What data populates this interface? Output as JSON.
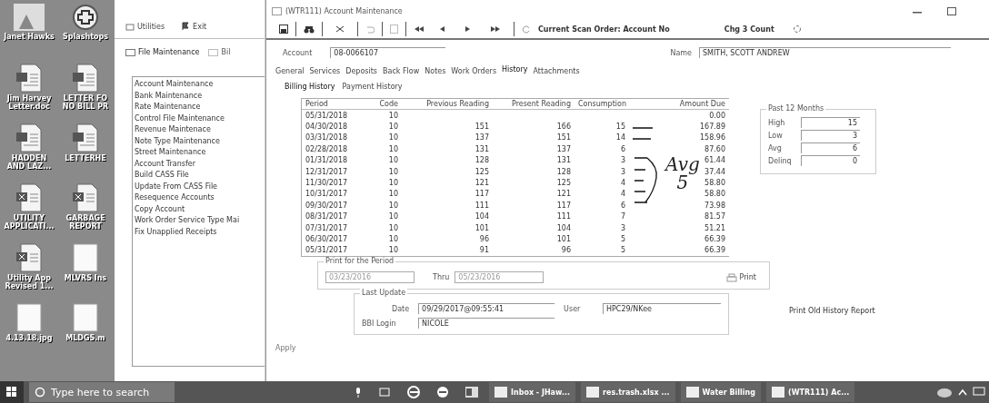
{
  "desktop_icons": [
    {
      "label": "Janet Hawks",
      "kind": "photo"
    },
    {
      "label": "Splashtops",
      "kind": "app"
    },
    {
      "label": "Jim Harvey Letter.doc",
      "kind": "word"
    },
    {
      "label": "LETTER FO NO BILL PR",
      "kind": "word"
    },
    {
      "label": "HADDEN AND LAZ...",
      "kind": "word"
    },
    {
      "label": "LETTERHE",
      "kind": "word"
    },
    {
      "label": "UTILITY APPLICATI...",
      "kind": "excel"
    },
    {
      "label": "GARBAGE REPORT",
      "kind": "excel"
    },
    {
      "label": "Utility App Revised 1...",
      "kind": "excel"
    },
    {
      "label": "MLVRS Ins",
      "kind": "blank"
    },
    {
      "label": "4.13.18.jpg",
      "kind": "blank"
    },
    {
      "label": "MLDGS.m",
      "kind": "blank"
    }
  ],
  "back_window": {
    "toolbar": [
      "Utilities",
      "Exit"
    ],
    "tabs": [
      {
        "label": "File Maintenance",
        "selected": true
      },
      {
        "label": "Bil",
        "selected": false
      }
    ],
    "items": [
      "Account Maintenance",
      "Bank Maintenance",
      "Rate Maintenance",
      "Control File Maintenance",
      "Revenue Maintenace",
      "Note Type Maintenance",
      "Street Maintenance",
      "Account Transfer",
      "Build CASS File",
      "Update From CASS File",
      "Resequence Accounts",
      "Copy Account",
      "Work Order Service Type Mai",
      "Fix Unapplied Receipts"
    ]
  },
  "window": {
    "title": "(WTR111) Account Maintenance",
    "scan_order": "Current Scan Order: Account No",
    "count": "Chg 3 Count"
  },
  "account": {
    "label": "Account",
    "value": "08-0066107"
  },
  "name": {
    "label": "Name",
    "value": "SMITH, SCOTT ANDREW"
  },
  "tabs": [
    {
      "label": "General",
      "selected": false
    },
    {
      "label": "Services",
      "selected": false
    },
    {
      "label": "Deposits",
      "selected": false
    },
    {
      "label": "Back Flow",
      "selected": false
    },
    {
      "label": "Notes",
      "selected": false
    },
    {
      "label": "Work Orders",
      "selected": false
    },
    {
      "label": "History",
      "selected": true
    },
    {
      "label": "Attachments",
      "selected": false
    }
  ],
  "subtabs": [
    {
      "label": "Billing History",
      "selected": true
    },
    {
      "label": "Payment History",
      "selected": false
    }
  ],
  "table": {
    "columns": [
      "Period",
      "Code",
      "Previous Reading",
      "Present Reading",
      "Consumption",
      "Amount Due"
    ],
    "rows": [
      [
        "05/31/2018",
        "10",
        "",
        "",
        "",
        "0.00"
      ],
      [
        "04/30/2018",
        "10",
        "151",
        "166",
        "15",
        "167.89"
      ],
      [
        "03/31/2018",
        "10",
        "137",
        "151",
        "14",
        "158.96"
      ],
      [
        "02/28/2018",
        "10",
        "131",
        "137",
        "6",
        "87.60"
      ],
      [
        "01/31/2018",
        "10",
        "128",
        "131",
        "3",
        "61.44"
      ],
      [
        "12/31/2017",
        "10",
        "125",
        "128",
        "3",
        "37.44"
      ],
      [
        "11/30/2017",
        "10",
        "121",
        "125",
        "4",
        "58.80"
      ],
      [
        "10/31/2017",
        "10",
        "117",
        "121",
        "4",
        "58.80"
      ],
      [
        "09/30/2017",
        "10",
        "111",
        "117",
        "6",
        "73.98"
      ],
      [
        "08/31/2017",
        "10",
        "104",
        "111",
        "7",
        "81.57"
      ],
      [
        "07/31/2017",
        "10",
        "101",
        "104",
        "3",
        "51.21"
      ],
      [
        "06/30/2017",
        "10",
        "96",
        "101",
        "5",
        "66.39"
      ],
      [
        "05/31/2017",
        "10",
        "91",
        "96",
        "5",
        "66.39"
      ]
    ]
  },
  "handwriting": [
    "Avg",
    "5"
  ],
  "past_12_months": {
    "title": "Past 12 Months",
    "stats": [
      {
        "label": "High",
        "value": "15"
      },
      {
        "label": "Low",
        "value": "3"
      },
      {
        "label": "Avg",
        "value": "6"
      },
      {
        "label": "Delinq",
        "value": "0"
      }
    ]
  },
  "print_period": {
    "title": "Print for the Period",
    "from": "03/23/2016",
    "thru_label": "Thru",
    "thru": "05/23/2016",
    "button": "Print"
  },
  "last_update": {
    "title": "Last Update",
    "date_label": "Date",
    "date": "09/29/2017@09:55:41",
    "user_label": "User",
    "user": "HPC29/NKee",
    "login_label": "BBI Login",
    "login": "NICOLE"
  },
  "print_old_report": "Print Old History Report",
  "apply": "Apply",
  "taskbar": {
    "search_placeholder": "Type here to search",
    "apps": [
      {
        "label": "Inbox - JHaw..."
      },
      {
        "label": "res.trash.xlsx ..."
      },
      {
        "label": "Water Billing"
      },
      {
        "label": "(WTR111) Ac..."
      }
    ]
  }
}
